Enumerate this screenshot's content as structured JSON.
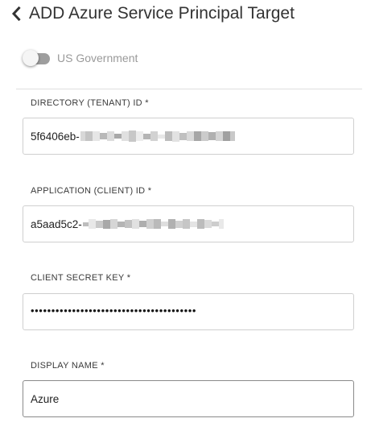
{
  "header": {
    "back_icon": "chevron-left-icon",
    "title": "ADD Azure Service Principal Target"
  },
  "gov_toggle": {
    "label": "US Government",
    "checked": false
  },
  "fields": {
    "directory": {
      "label": "DIRECTORY (TENANT) ID *",
      "value_visible": "5f6406eb-"
    },
    "application": {
      "label": "APPLICATION (CLIENT) ID *",
      "value_visible": "a5aad5c2-"
    },
    "secret": {
      "label": "CLIENT SECRET KEY *",
      "value_masked": "••••••••••••••••••••••••••••••••••••••••"
    },
    "display_name": {
      "label": "DISPLAY NAME *",
      "value": "Azure"
    }
  }
}
